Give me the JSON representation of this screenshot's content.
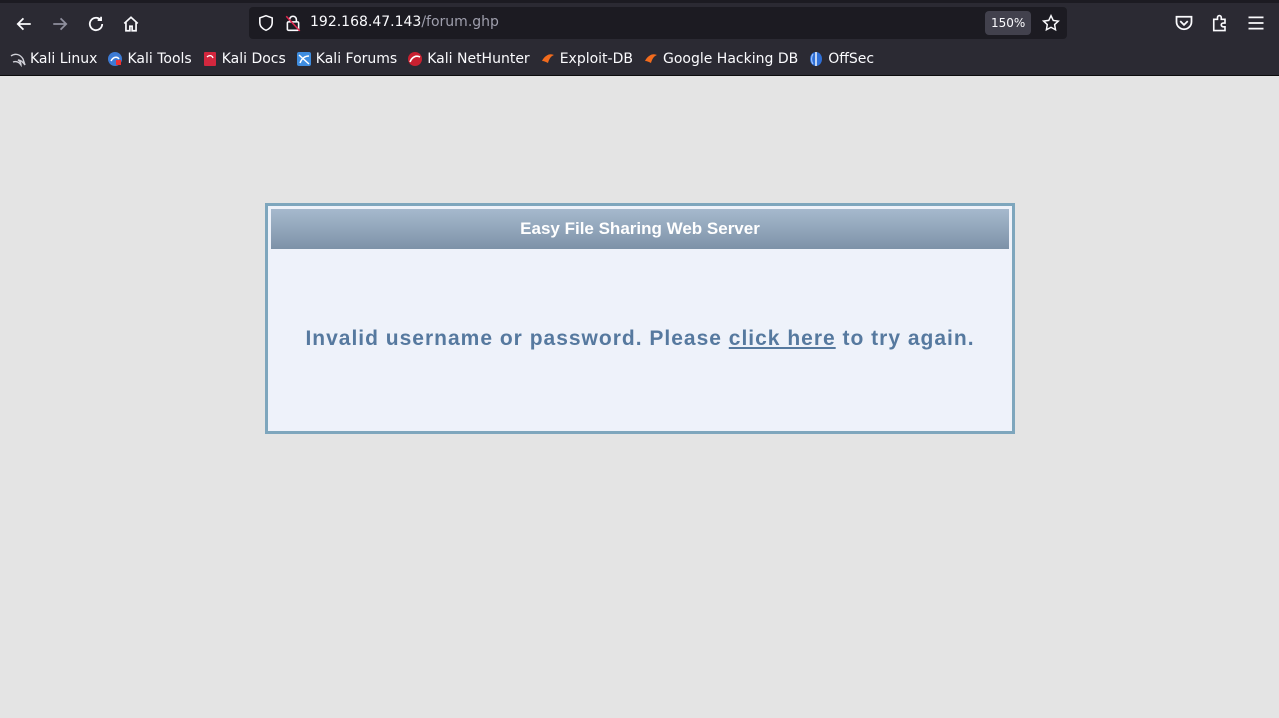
{
  "browser": {
    "url_host": "192.168.47.143",
    "url_path": "/forum.ghp",
    "zoom": "150%",
    "bookmarks": [
      {
        "label": "Kali Linux",
        "icon": "kali-dragon-icon"
      },
      {
        "label": "Kali Tools",
        "icon": "kali-tools-icon"
      },
      {
        "label": "Kali Docs",
        "icon": "kali-docs-icon"
      },
      {
        "label": "Kali Forums",
        "icon": "kali-forums-icon"
      },
      {
        "label": "Kali NetHunter",
        "icon": "kali-nethunter-icon"
      },
      {
        "label": "Exploit-DB",
        "icon": "exploit-db-icon"
      },
      {
        "label": "Google Hacking DB",
        "icon": "google-hacking-db-icon"
      },
      {
        "label": "OffSec",
        "icon": "offsec-icon"
      }
    ]
  },
  "page": {
    "header_title": "Easy File Sharing Web Server",
    "message_before": "Invalid username or password. Please ",
    "link_text": "click here",
    "message_after": " to try again."
  },
  "colors": {
    "background": "#e4e4e4",
    "panel_border": "#7ea6bd",
    "panel_bg": "#eef2fa",
    "text_accent": "#56799f"
  }
}
